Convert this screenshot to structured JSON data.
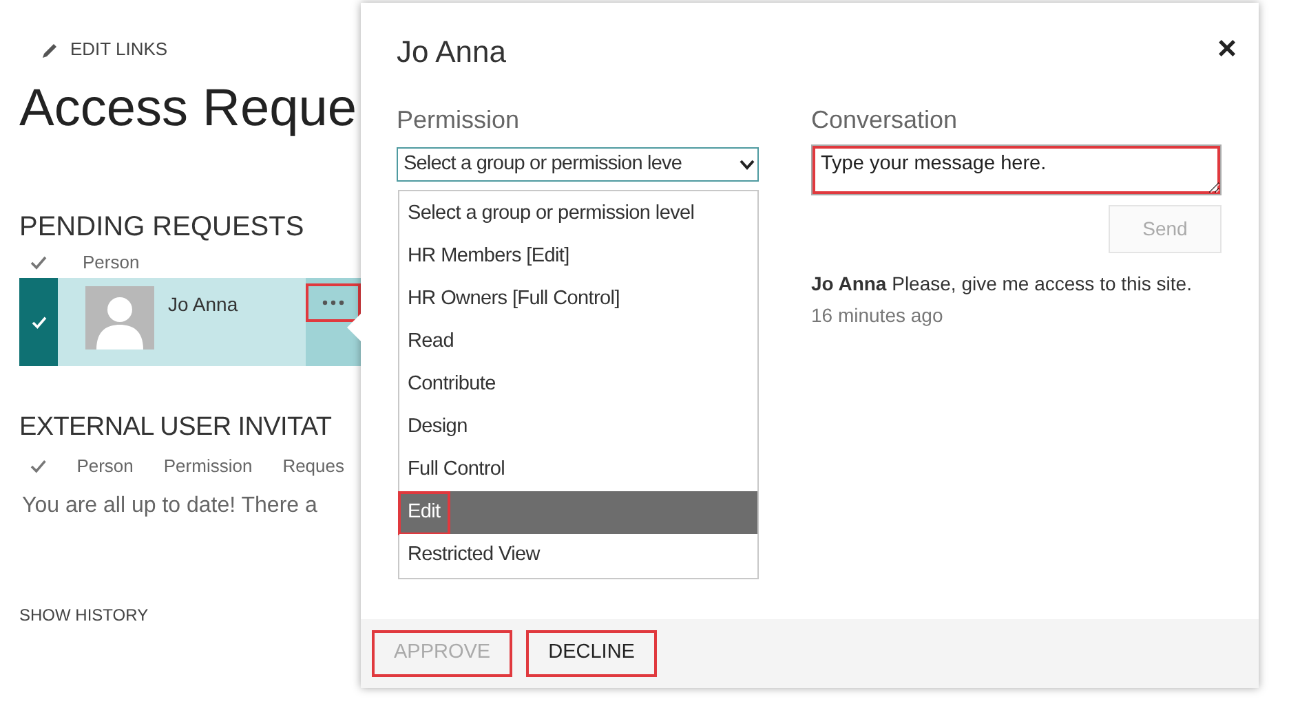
{
  "page": {
    "edit_links": "EDIT LINKS",
    "title": "Access Reque"
  },
  "pending_requests": {
    "heading": "PENDING REQUESTS",
    "columns": [
      "Person"
    ],
    "rows": [
      {
        "person": "Jo Anna",
        "selected": true,
        "menu_highlighted": true
      }
    ]
  },
  "external_invitations": {
    "heading": "EXTERNAL USER INVITAT",
    "columns": [
      "Person",
      "Permission",
      "Reques"
    ],
    "empty_message": "You are all up to date! There a"
  },
  "show_history": "SHOW HISTORY",
  "dialog": {
    "title": "Jo Anna",
    "close": "×",
    "permission": {
      "label": "Permission",
      "value": "Select a group or permission leve",
      "options": [
        {
          "label": "Select a group or permission level",
          "selected": false,
          "highlighted": false
        },
        {
          "label": "HR Members [Edit]",
          "selected": false,
          "highlighted": false
        },
        {
          "label": "HR Owners [Full Control]",
          "selected": false,
          "highlighted": false
        },
        {
          "label": "Read",
          "selected": false,
          "highlighted": false
        },
        {
          "label": "Contribute",
          "selected": false,
          "highlighted": false
        },
        {
          "label": "Design",
          "selected": false,
          "highlighted": false
        },
        {
          "label": "Full Control",
          "selected": false,
          "highlighted": false
        },
        {
          "label": "Edit",
          "selected": true,
          "highlighted": true
        },
        {
          "label": "Restricted View",
          "selected": false,
          "highlighted": false
        }
      ]
    },
    "conversation": {
      "label": "Conversation",
      "placeholder": "Type your message here.",
      "highlighted": true,
      "send": {
        "label": "Send",
        "disabled": true
      },
      "messages": [
        {
          "author": "Jo Anna",
          "text": "Please, give me access to this site.",
          "time": "16 minutes ago"
        }
      ]
    },
    "buttons": [
      {
        "label": "APPROVE",
        "disabled": true,
        "highlighted": true
      },
      {
        "label": "DECLINE",
        "disabled": false,
        "highlighted": true
      }
    ]
  }
}
